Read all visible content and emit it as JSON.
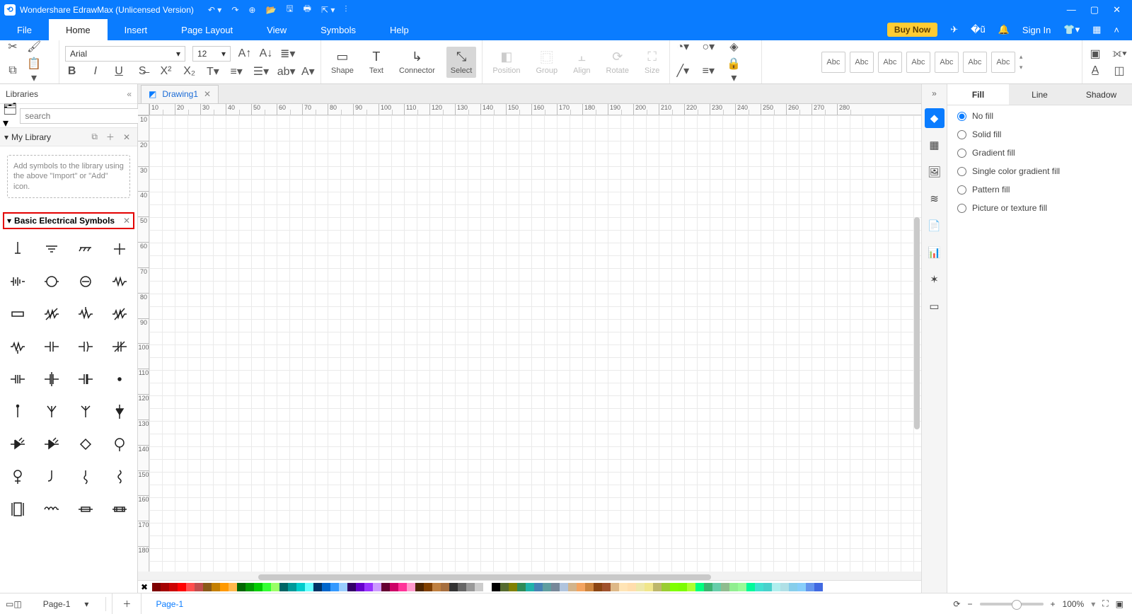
{
  "titlebar": {
    "title": "Wondershare EdrawMax (Unlicensed Version)"
  },
  "menu": {
    "items": [
      "File",
      "Home",
      "Insert",
      "Page Layout",
      "View",
      "Symbols",
      "Help"
    ],
    "active": 1,
    "buy_now": "Buy Now",
    "sign_in": "Sign In"
  },
  "ribbon": {
    "font_name": "Arial",
    "font_size": "12",
    "tools": {
      "shape": "Shape",
      "text": "Text",
      "connector": "Connector",
      "select": "Select",
      "position": "Position",
      "group": "Group",
      "align": "Align",
      "rotate": "Rotate",
      "size": "Size"
    },
    "thumb_label": "Abc"
  },
  "left": {
    "libraries_label": "Libraries",
    "search_placeholder": "search",
    "mylib_label": "My Library",
    "mylib_placeholder": "Add symbols to the library using the above \"Import\" or \"Add\" icon.",
    "elec_label": "Basic Electrical Symbols"
  },
  "doc_tab": {
    "name": "Drawing1"
  },
  "hruler": [
    "10",
    "20",
    "30",
    "40",
    "50",
    "60",
    "70",
    "80",
    "90",
    "100",
    "110",
    "120",
    "130",
    "140",
    "150",
    "160",
    "170",
    "180",
    "190",
    "200",
    "210",
    "220",
    "230",
    "240",
    "250",
    "260",
    "270",
    "280"
  ],
  "vruler": [
    "10",
    "20",
    "30",
    "40",
    "50",
    "60",
    "70",
    "80",
    "90",
    "100",
    "110",
    "120",
    "130",
    "140",
    "150",
    "160",
    "170",
    "180"
  ],
  "right": {
    "tabs": [
      "Fill",
      "Line",
      "Shadow"
    ],
    "active": 0,
    "opts": [
      "No fill",
      "Solid fill",
      "Gradient fill",
      "Single color gradient fill",
      "Pattern fill",
      "Picture or texture fill"
    ],
    "checked": 0
  },
  "palette": [
    "#7e0000",
    "#a40000",
    "#cc0000",
    "#ff0000",
    "#ff4d4d",
    "#c14d4d",
    "#8a5a19",
    "#c47f00",
    "#ff9900",
    "#ffb84d",
    "#006600",
    "#009900",
    "#00cc00",
    "#33ff33",
    "#99ff66",
    "#006666",
    "#009999",
    "#00cccc",
    "#66ffff",
    "#003366",
    "#0066cc",
    "#3399ff",
    "#99ccff",
    "#330066",
    "#6600cc",
    "#9933ff",
    "#cc99ff",
    "#660033",
    "#cc0066",
    "#ff3399",
    "#ff99cc",
    "#4d2600",
    "#804000",
    "#bf8040",
    "#a66f3f",
    "#333333",
    "#666666",
    "#999999",
    "#cccccc",
    "#ffffff",
    "#000000",
    "#556b2f",
    "#808000",
    "#2e8b57",
    "#20b2aa",
    "#4682b4",
    "#5f9ea0",
    "#778899",
    "#b0c4de",
    "#d2b48c",
    "#f4a460",
    "#cd853f",
    "#8b4513",
    "#a0522d",
    "#deb887",
    "#ffe4b5",
    "#ffdead",
    "#eee8aa",
    "#f0e68c",
    "#bdb76b",
    "#9acd32",
    "#7fff00",
    "#7cfc00",
    "#adff2f",
    "#00ff7f",
    "#3cb371",
    "#66cdaa",
    "#8fbc8f",
    "#90ee90",
    "#98fb98",
    "#00fa9a",
    "#40e0d0",
    "#48d1cc",
    "#afeeee",
    "#b0e0e6",
    "#87ceeb",
    "#87cefa",
    "#6495ed",
    "#4169e1"
  ],
  "status": {
    "page_sel": "Page-1",
    "page_tab": "Page-1",
    "zoom_pct": "100%"
  }
}
